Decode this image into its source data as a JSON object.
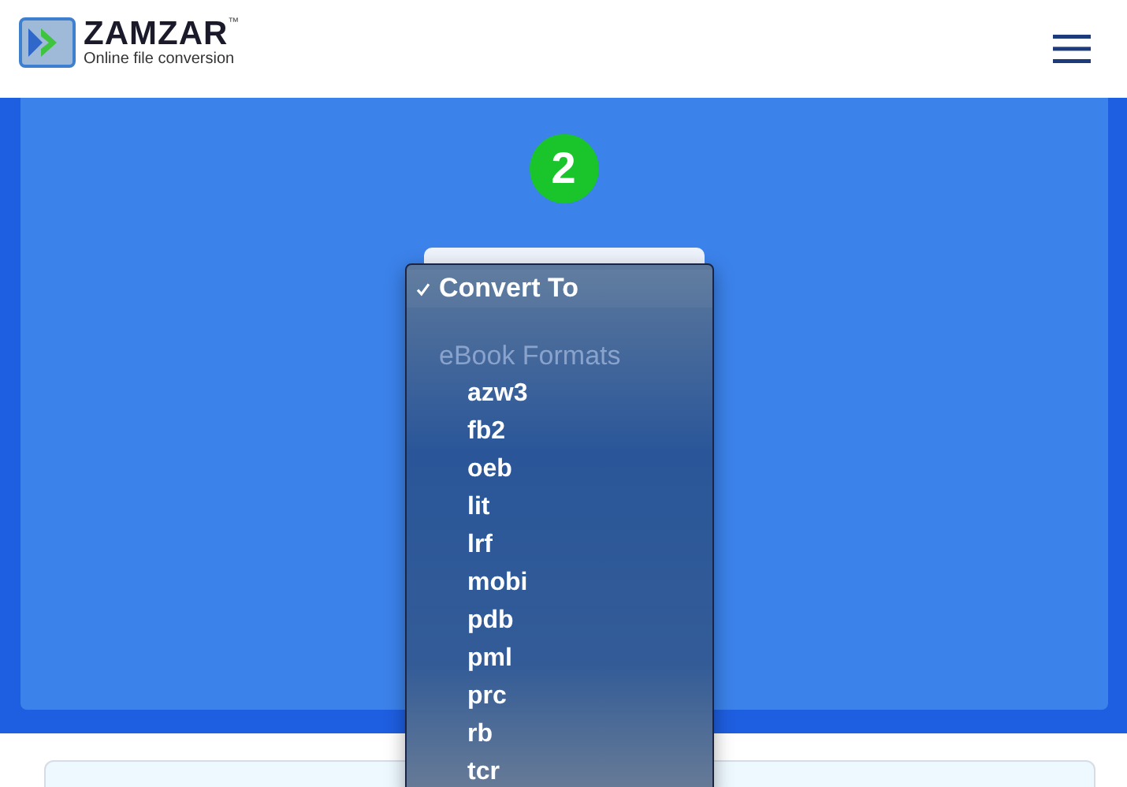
{
  "header": {
    "logo": {
      "name": "ZAMZAR",
      "trademark": "™",
      "tagline": "Online file conversion"
    }
  },
  "step": {
    "number": "2"
  },
  "dropdown": {
    "items": [
      {
        "kind": "option",
        "label": "Convert To",
        "selected": true
      },
      {
        "kind": "group",
        "label": "eBook Formats"
      },
      {
        "kind": "option",
        "label": "azw3",
        "selected": false
      },
      {
        "kind": "option",
        "label": "fb2",
        "selected": false
      },
      {
        "kind": "option",
        "label": "oeb",
        "selected": false
      },
      {
        "kind": "option",
        "label": "lit",
        "selected": false
      },
      {
        "kind": "option",
        "label": "lrf",
        "selected": false
      },
      {
        "kind": "option",
        "label": "mobi",
        "selected": false
      },
      {
        "kind": "option",
        "label": "pdb",
        "selected": false
      },
      {
        "kind": "option",
        "label": "pml",
        "selected": false
      },
      {
        "kind": "option",
        "label": "prc",
        "selected": false
      },
      {
        "kind": "option",
        "label": "rb",
        "selected": false
      },
      {
        "kind": "option",
        "label": "tcr",
        "selected": false
      }
    ]
  }
}
